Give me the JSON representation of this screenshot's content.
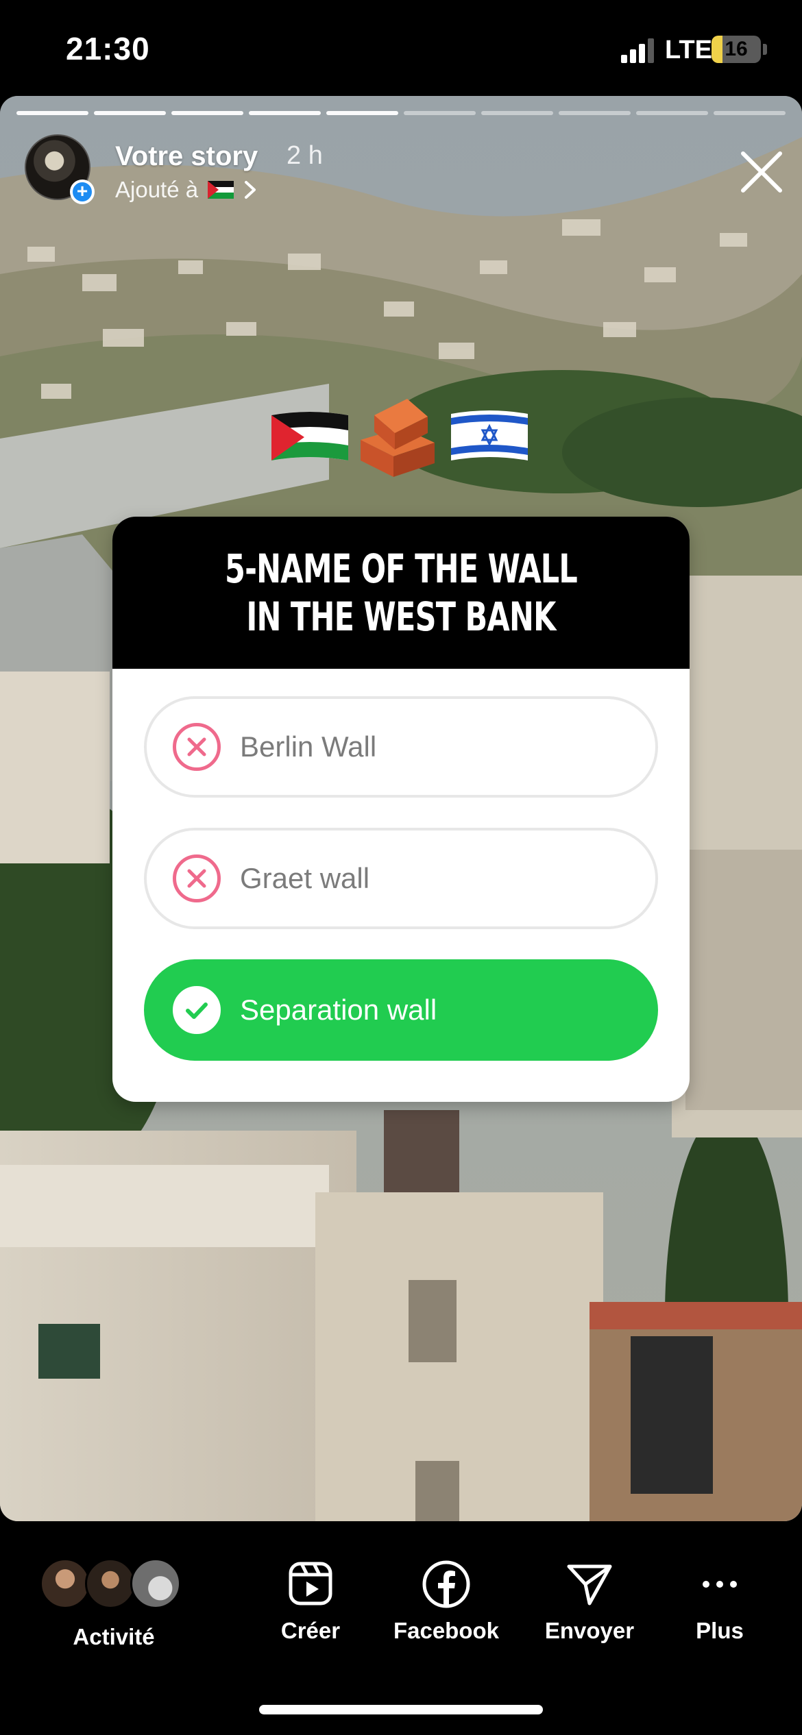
{
  "status_bar": {
    "time": "21:30",
    "network": "LTE",
    "battery": "16",
    "battery_level": 0.16,
    "signal_bars": 3
  },
  "story": {
    "title": "Votre story",
    "time_ago": "2 h",
    "added_to_label": "Ajouté à",
    "progress_segments": 10,
    "progress_current": 5,
    "stickers": [
      "palestine-flag-emoji",
      "bricks-emoji",
      "israel-flag-emoji"
    ]
  },
  "quiz": {
    "question": "5-NAME OF THE WALL IN THE WEST BANK",
    "options": [
      {
        "label": "Berlin Wall",
        "state": "wrong"
      },
      {
        "label": "Graet wall",
        "state": "wrong"
      },
      {
        "label": "Separation wall",
        "state": "correct"
      }
    ]
  },
  "bottom_bar": {
    "activity_label": "Activité",
    "create_label": "Créer",
    "facebook_label": "Facebook",
    "send_label": "Envoyer",
    "more_label": "Plus"
  },
  "colors": {
    "correct": "#21cc50",
    "wrong": "#ef6a8c",
    "accent_blue": "#1d8cf2",
    "battery_yellow": "#f0d24a"
  }
}
